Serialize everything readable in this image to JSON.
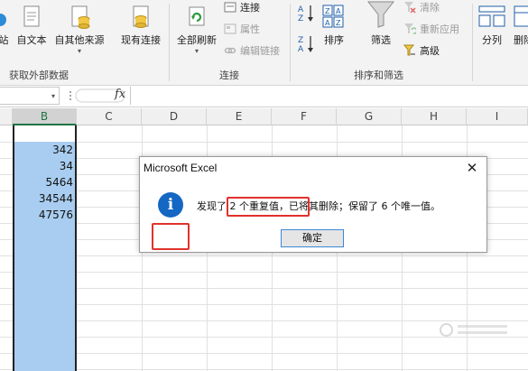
{
  "ribbon": {
    "groups": {
      "get_external_data": {
        "label": "获取外部数据",
        "items": [
          {
            "label": "站",
            "icon": "web-icon"
          },
          {
            "label": "自文本",
            "icon": "text-file-icon"
          },
          {
            "label": "自其他来源",
            "icon": "other-sources-icon"
          },
          {
            "label": "现有连接",
            "icon": "existing-connections-icon"
          }
        ]
      },
      "connections": {
        "label": "连接",
        "refresh_all": "全部刷新",
        "connections_item": "连接",
        "properties_item": "属性",
        "edit_links_item": "编辑链接"
      },
      "sort_filter": {
        "label": "排序和筛选",
        "sort_label": "排序",
        "filter_label": "筛选",
        "clear_item": "清除",
        "reapply_item": "重新应用",
        "advanced_item": "高级"
      },
      "data_tools": {
        "split_label": "分列",
        "remove_label": "删除重复项"
      }
    }
  },
  "formula_bar": {
    "name_box": "",
    "fx_label": "fx",
    "formula": ""
  },
  "grid": {
    "columns": [
      "B",
      "C",
      "D",
      "E",
      "F",
      "G",
      "H",
      "I"
    ],
    "selected_column": "B",
    "values": [
      "342",
      "34",
      "5464",
      "34544",
      "47576"
    ]
  },
  "dialog": {
    "title": "Microsoft Excel",
    "close_glyph": "✕",
    "icon_glyph": "i",
    "message": "发现了 2 个重复值，已将其删除；保留了 6 个唯一值。",
    "ok_label": "确定"
  },
  "colors": {
    "accent_green": "#217346",
    "selection_blue": "#a9cdf0",
    "highlight_red": "#e0322c",
    "info_blue": "#1467c2"
  }
}
